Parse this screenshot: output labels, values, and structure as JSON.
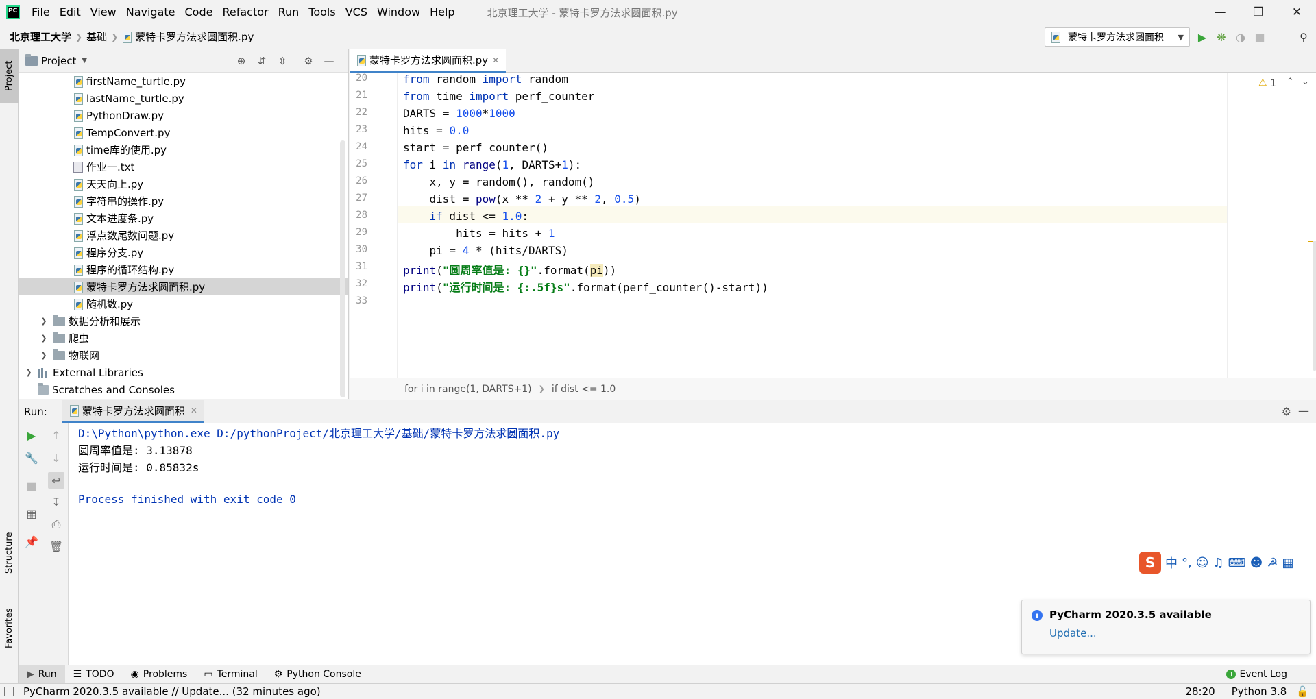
{
  "menubar": {
    "logo_text": "PC",
    "items": [
      "File",
      "Edit",
      "View",
      "Navigate",
      "Code",
      "Refactor",
      "Run",
      "Tools",
      "VCS",
      "Window",
      "Help"
    ],
    "window_title": "北京理工大学 - 蒙特卡罗方法求圆面积.py"
  },
  "navbar": {
    "crumbs": [
      "北京理工大学",
      "基础",
      "蒙特卡罗方法求圆面积.py"
    ],
    "run_config": "蒙特卡罗方法求圆面积"
  },
  "left_strip": {
    "project": "Project",
    "structure": "Structure",
    "favorites": "Favorites"
  },
  "project": {
    "title": "Project",
    "files": [
      "firstName_turtle.py",
      "lastName_turtle.py",
      "PythonDraw.py",
      "TempConvert.py",
      "time库的使用.py",
      "作业一.txt",
      "天天向上.py",
      "字符串的操作.py",
      "文本进度条.py",
      "浮点数尾数问题.py",
      "程序分支.py",
      "程序的循环结构.py",
      "蒙特卡罗方法求圆面积.py",
      "随机数.py"
    ],
    "folders": [
      "数据分析和展示",
      "爬虫",
      "物联网"
    ],
    "external": "External Libraries",
    "scratches": "Scratches and Consoles"
  },
  "editor": {
    "tab": "蒙特卡罗方法求圆面积.py",
    "line_numbers": [
      "20",
      "21",
      "22",
      "23",
      "24",
      "25",
      "26",
      "27",
      "28",
      "29",
      "30",
      "31",
      "32",
      "33"
    ],
    "warning_count": "1",
    "breadcrumb": [
      "for i in range(1, DARTS+1)",
      "if dist <= 1.0"
    ]
  },
  "run": {
    "label": "Run:",
    "tab": "蒙特卡罗方法求圆面积",
    "output": [
      "D:\\Python\\python.exe D:/pythonProject/北京理工大学/基础/蒙特卡罗方法求圆面积.py",
      "圆周率值是: 3.13878",
      "运行时间是: 0.85832s",
      "",
      "Process finished with exit code 0"
    ]
  },
  "bottom_tabs": [
    "Run",
    "TODO",
    "Problems",
    "Terminal",
    "Python Console"
  ],
  "event_log": "Event Log",
  "notification": {
    "title": "PyCharm 2020.3.5 available",
    "link": "Update..."
  },
  "ime": {
    "lang": "中"
  },
  "status": {
    "message": "PyCharm 2020.3.5 available // Update... (32 minutes ago)",
    "position": "28:20",
    "interpreter": "Python 3.8"
  }
}
